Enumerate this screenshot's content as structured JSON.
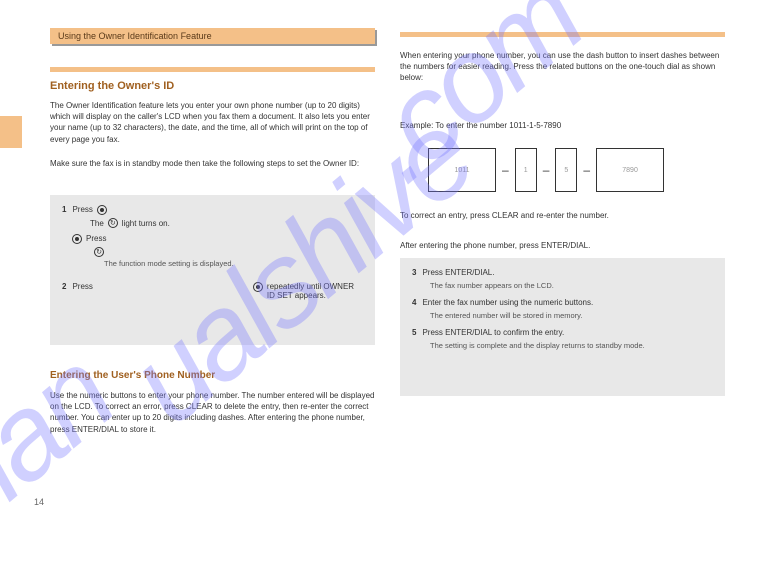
{
  "watermark": {
    "part1": ".com",
    "part2": "ualshive",
    "part3": "man"
  },
  "header": {
    "title": "Using the Owner Identification Feature"
  },
  "left": {
    "section_title": "Entering the Owner's ID",
    "para1": "The Owner Identification feature lets you enter your own phone number (up to 20 digits) which will display on the caller's LCD when you fax them a document. It also lets you enter your name (up to 32 characters), the date, and the time, all of which will print on the top of every page you fax.",
    "para2": "Make sure the fax is in standby mode then take the following steps to set the Owner ID:",
    "steps": {
      "s1_num": "1",
      "s1_text": "Press",
      "s1a_text": "The",
      "s1a_icon": "radio",
      "s1a_after": "light turns on.",
      "s1b_text": "Press",
      "s1b_icon_label": "arrow",
      "s1b_sub": "The function mode setting is displayed.",
      "s2_num": "2",
      "s2_text": "Press",
      "s2_after": "repeatedly until OWNER ID SET appears."
    },
    "subhead": "Entering the User's Phone Number",
    "para3": "Use the numeric buttons to enter your phone number. The number entered will be displayed on the LCD. To correct an error, press CLEAR to delete the entry, then re-enter the correct number. You can enter up to 20 digits including dashes. After entering the phone number, press ENTER/DIAL to store it."
  },
  "right": {
    "text1": "When entering your phone number, you can use the dash button to insert dashes between the numbers for easier reading. Press the related buttons on the one-touch dial as shown below:",
    "text2": "Example: To enter the number 1011-1-5-7890",
    "boxes": {
      "b1": "1011",
      "b2": "1",
      "b3": "5",
      "b4": "7890"
    },
    "text3": "To correct an entry, press CLEAR and re-enter the number.",
    "text4": "After entering the phone number, press ENTER/DIAL.",
    "steps": {
      "s3_num": "3",
      "s3_text": "Press ENTER/DIAL.",
      "s3_sub": "The fax number appears on the LCD.",
      "s4_num": "4",
      "s4_text": "Enter the fax number using the numeric buttons.",
      "s4_sub": "The entered number will be stored in memory.",
      "s5_num": "5",
      "s5_text": "Press ENTER/DIAL to confirm the entry.",
      "s5_sub": "The setting is complete and the display returns to standby mode."
    }
  },
  "page_number": "14"
}
